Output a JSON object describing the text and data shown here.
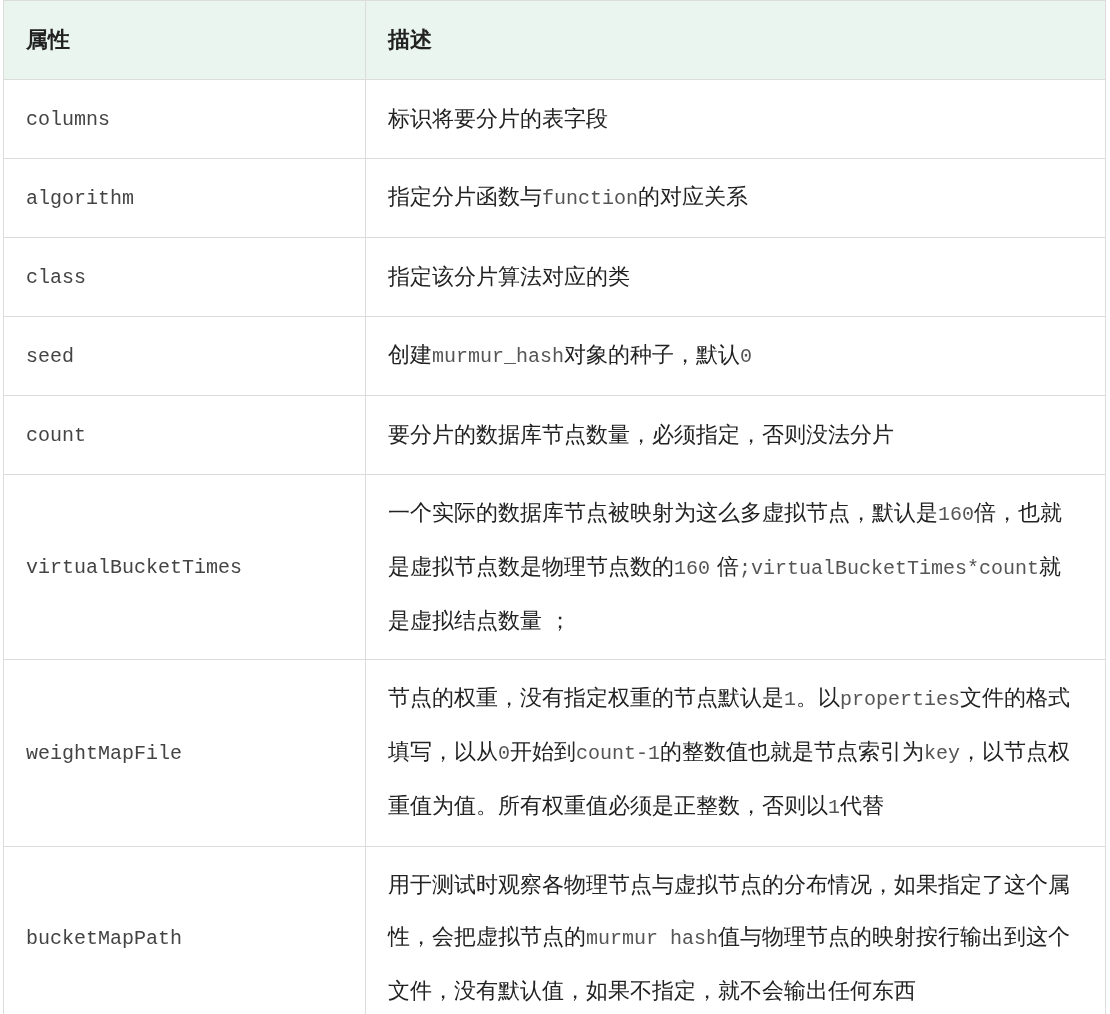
{
  "table": {
    "columns": [
      "属性",
      "描述"
    ],
    "rows": [
      {
        "attribute": "columns",
        "description": [
          {
            "kind": "text",
            "text": "标识将要分片的表字段"
          }
        ]
      },
      {
        "attribute": "algorithm",
        "description": [
          {
            "kind": "text",
            "text": "指定分片函数与"
          },
          {
            "kind": "code",
            "text": "function"
          },
          {
            "kind": "text",
            "text": "的对应关系"
          }
        ]
      },
      {
        "attribute": "class",
        "description": [
          {
            "kind": "text",
            "text": "指定该分片算法对应的类"
          }
        ]
      },
      {
        "attribute": "seed",
        "description": [
          {
            "kind": "text",
            "text": "创建"
          },
          {
            "kind": "code",
            "text": "murmur_hash"
          },
          {
            "kind": "text",
            "text": "对象的种子，默认"
          },
          {
            "kind": "code",
            "text": "0"
          }
        ]
      },
      {
        "attribute": "count",
        "description": [
          {
            "kind": "text",
            "text": "要分片的数据库节点数量，必须指定，否则没法分片"
          }
        ]
      },
      {
        "attribute": "virtualBucketTimes",
        "description": [
          {
            "kind": "text",
            "text": "一个实际的数据库节点被映射为这么多虚拟节点，默认是"
          },
          {
            "kind": "code",
            "text": "160"
          },
          {
            "kind": "text",
            "text": "倍，也就是虚拟节点数是物理节点数的"
          },
          {
            "kind": "code",
            "text": "160"
          },
          {
            "kind": "text",
            "text": " 倍"
          },
          {
            "kind": "code",
            "text": ";virtualBucketTimes*count"
          },
          {
            "kind": "text",
            "text": "就是虚拟结点数量 ；"
          }
        ]
      },
      {
        "attribute": "weightMapFile",
        "description": [
          {
            "kind": "text",
            "text": "节点的权重，没有指定权重的节点默认是"
          },
          {
            "kind": "code",
            "text": "1"
          },
          {
            "kind": "text",
            "text": "。以"
          },
          {
            "kind": "code",
            "text": "properties"
          },
          {
            "kind": "text",
            "text": "文件的格式填写，以从"
          },
          {
            "kind": "code",
            "text": "0"
          },
          {
            "kind": "text",
            "text": "开始到"
          },
          {
            "kind": "code",
            "text": "count-1"
          },
          {
            "kind": "text",
            "text": "的整数值也就是节点索引为"
          },
          {
            "kind": "code",
            "text": "key"
          },
          {
            "kind": "text",
            "text": "，以节点权重值为值。所有权重值必须是正整数，否则以"
          },
          {
            "kind": "code",
            "text": "1"
          },
          {
            "kind": "text",
            "text": "代替"
          }
        ]
      },
      {
        "attribute": "bucketMapPath",
        "description": [
          {
            "kind": "text",
            "text": "用于测试时观察各物理节点与虚拟节点的分布情况，如果指定了这个属性，会把虚拟节点的"
          },
          {
            "kind": "code",
            "text": "murmur hash"
          },
          {
            "kind": "text",
            "text": "值与物理节点的映射按行输出到这个文件，没有默认值，如果不指定，就不会输出任何东西"
          }
        ]
      }
    ]
  }
}
